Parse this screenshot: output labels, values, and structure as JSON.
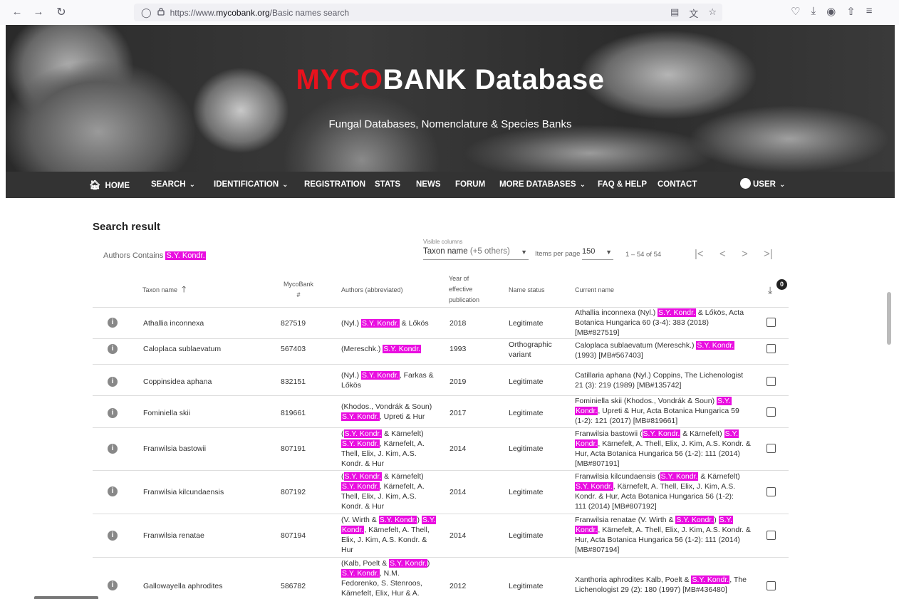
{
  "browser": {
    "url_prefix": "https://www.",
    "url_domain": "mycobank.org",
    "url_path": "/Basic names search"
  },
  "hero": {
    "title_red": "MYCO",
    "title_rest": "BANK Database",
    "subtitle": "Fungal Databases, Nomenclature & Species Banks"
  },
  "nav": {
    "home": "HOME",
    "search": "SEARCH",
    "identification": "IDENTIFICATION",
    "registration": "REGISTRATION",
    "stats": "STATS",
    "news": "NEWS",
    "forum": "FORUM",
    "more_databases": "MORE DATABASES",
    "faq": "FAQ & HELP",
    "contact": "CONTACT",
    "user": "USER"
  },
  "results": {
    "title": "Search result",
    "filter_prefix": "Authors Contains ",
    "filter_value": "S.Y. Kondr.",
    "visible_columns_label": "Visible columns",
    "visible_columns_value": "Taxon name",
    "visible_columns_extra": "(+5 others)",
    "items_per_page_label": "Items per page",
    "items_per_page_value": "150",
    "range": "1 – 54 of 54",
    "download_count": "0"
  },
  "columns": {
    "taxon": "Taxon name",
    "mycobank_1": "MycoBank",
    "mycobank_2": "#",
    "authors": "Authors (abbreviated)",
    "year_1": "Year of",
    "year_2": "effective",
    "year_3": "publication",
    "status": "Name status",
    "current": "Current name"
  },
  "rows": [
    {
      "taxon": "Athallia inconnexa",
      "mb": "827519",
      "year": "2018",
      "status_1": "Legitimate",
      "status_2": "",
      "a1_pre": "(Nyl.) ",
      "a1_hl": "S.Y. Kondr.",
      "a1_post": " & Lőkös",
      "c1_pre": "Athallia inconnexa (Nyl.) ",
      "c1_hl": "S.Y. Kondr.",
      "c1_post": " & Lőkös, Acta",
      "c2": "Botanica Hungarica 60 (3-4): 383 (2018)",
      "c3": "[MB#827519]"
    },
    {
      "taxon": "Caloplaca sublaevatum",
      "mb": "567403",
      "year": "1993",
      "status_1": "Orthographic",
      "status_2": "variant",
      "a1_pre": "(Mereschk.) ",
      "a1_hl": "S.Y. Kondr.",
      "c1_pre": "Caloplaca sublaevatum (Mereschk.) ",
      "c1_hl": "S.Y. Kondr.",
      "c2": "(1993) [MB#567403]"
    },
    {
      "taxon": "Coppinsidea aphana",
      "mb": "832151",
      "year": "2019",
      "status_1": "Legitimate",
      "a1_pre": "(Nyl.) ",
      "a1_hl": "S.Y. Kondr.",
      "a1_post": ", Farkas &",
      "a2": "Lőkös",
      "c1": "Catillaria aphana (Nyl.) Coppins, The Lichenologist",
      "c2": "21 (3): 219 (1989) [MB#135742]"
    },
    {
      "taxon": "Fominiella skii",
      "mb": "819661",
      "year": "2017",
      "status_1": "Legitimate",
      "a1": "(Khodos., Vondrák & Soun)",
      "a2_hl": "S.Y. Kondr.",
      "a2_post": ", Upreti & Hur",
      "c1_pre": "Fominiella skii (Khodos., Vondrák & Soun) ",
      "c1_hl": "S.Y.",
      "c2_hl": "Kondr.",
      "c2_post": ", Upreti & Hur, Acta Botanica Hungarica 59",
      "c3": "(1-2): 121 (2017) [MB#819661]"
    },
    {
      "taxon": "Franwilsia bastowii",
      "mb": "807191",
      "year": "2014",
      "status_1": "Legitimate",
      "a1_pre": "(",
      "a1_hl": "S.Y. Kondr.",
      "a1_post": " & Kärnefelt)",
      "a2_hl": "S.Y. Kondr.",
      "a2_post": ", Kärnefelt, A.",
      "a3": "Thell, Elix, J. Kim, A.S.",
      "a4": "Kondr. & Hur",
      "c1_pre": "Franwilsia bastowii (",
      "c1_hl": "S.Y. Kondr.",
      "c1_mid": " & Kärnefelt) ",
      "c1_hl2": "S.Y.",
      "c2_hl": "Kondr.",
      "c2_post": ", Kärnefelt, A. Thell, Elix, J. Kim, A.S. Kondr. &",
      "c3": "Hur, Acta Botanica Hungarica 56 (1-2): 111 (2014)",
      "c4": "[MB#807191]"
    },
    {
      "taxon": "Franwilsia kilcundaensis",
      "mb": "807192",
      "year": "2014",
      "status_1": "Legitimate",
      "a1_pre": "(",
      "a1_hl": "S.Y. Kondr.",
      "a1_post": " & Kärnefelt)",
      "a2_hl": "S.Y. Kondr.",
      "a2_post": ", Kärnefelt, A.",
      "a3": "Thell, Elix, J. Kim, A.S.",
      "a4": "Kondr. & Hur",
      "c1_pre": "Franwilsia kilcundaensis (",
      "c1_hl": "S.Y. Kondr.",
      "c1_post": " & Kärnefelt)",
      "c2_hl": "S.Y. Kondr.",
      "c2_post": ", Kärnefelt, A. Thell, Elix, J. Kim, A.S.",
      "c3": "Kondr. & Hur, Acta Botanica Hungarica 56 (1-2):",
      "c4": "111 (2014) [MB#807192]"
    },
    {
      "taxon": "Franwilsia renatae",
      "mb": "807194",
      "year": "2014",
      "status_1": "Legitimate",
      "a1_pre": "(V. Wirth & ",
      "a1_hl": "S.Y. Kondr.",
      "a1_mid": ") ",
      "a1_hl2": "S.Y.",
      "a2_hl": "Kondr.",
      "a2_post": ", Kärnefelt, A. Thell,",
      "a3": "Elix, J. Kim, A.S. Kondr. &",
      "a4": "Hur",
      "c1_pre": "Franwilsia renatae (V. Wirth & ",
      "c1_hl": "S.Y. Kondr.",
      "c1_mid": ") ",
      "c1_hl2": "S.Y.",
      "c2_hl": "Kondr.",
      "c2_post": ", Kärnefelt, A. Thell, Elix, J. Kim, A.S. Kondr. &",
      "c3": "Hur, Acta Botanica Hungarica 56 (1-2): 111 (2014)",
      "c4": "[MB#807194]"
    },
    {
      "taxon": "Gallowayella aphrodites",
      "mb": "586782",
      "year": "2012",
      "status_1": "Legitimate",
      "a1_pre": "(Kalb, Poelt & ",
      "a1_hl": "S.Y. Kondr.",
      "a1_post": ")",
      "a2_hl": "S.Y. Kondr.",
      "a2_post": ", N.M.",
      "a3": "Fedorenko, S. Stenroos,",
      "a4": "Kärnefelt, Elix, Hur & A.",
      "c1_pre": "Xanthoria aphrodites Kalb, Poelt & ",
      "c1_hl": "S.Y. Kondr.",
      "c1_post": ", The",
      "c2": "Lichenologist 29 (2): 180 (1997) [MB#436480]"
    }
  ]
}
